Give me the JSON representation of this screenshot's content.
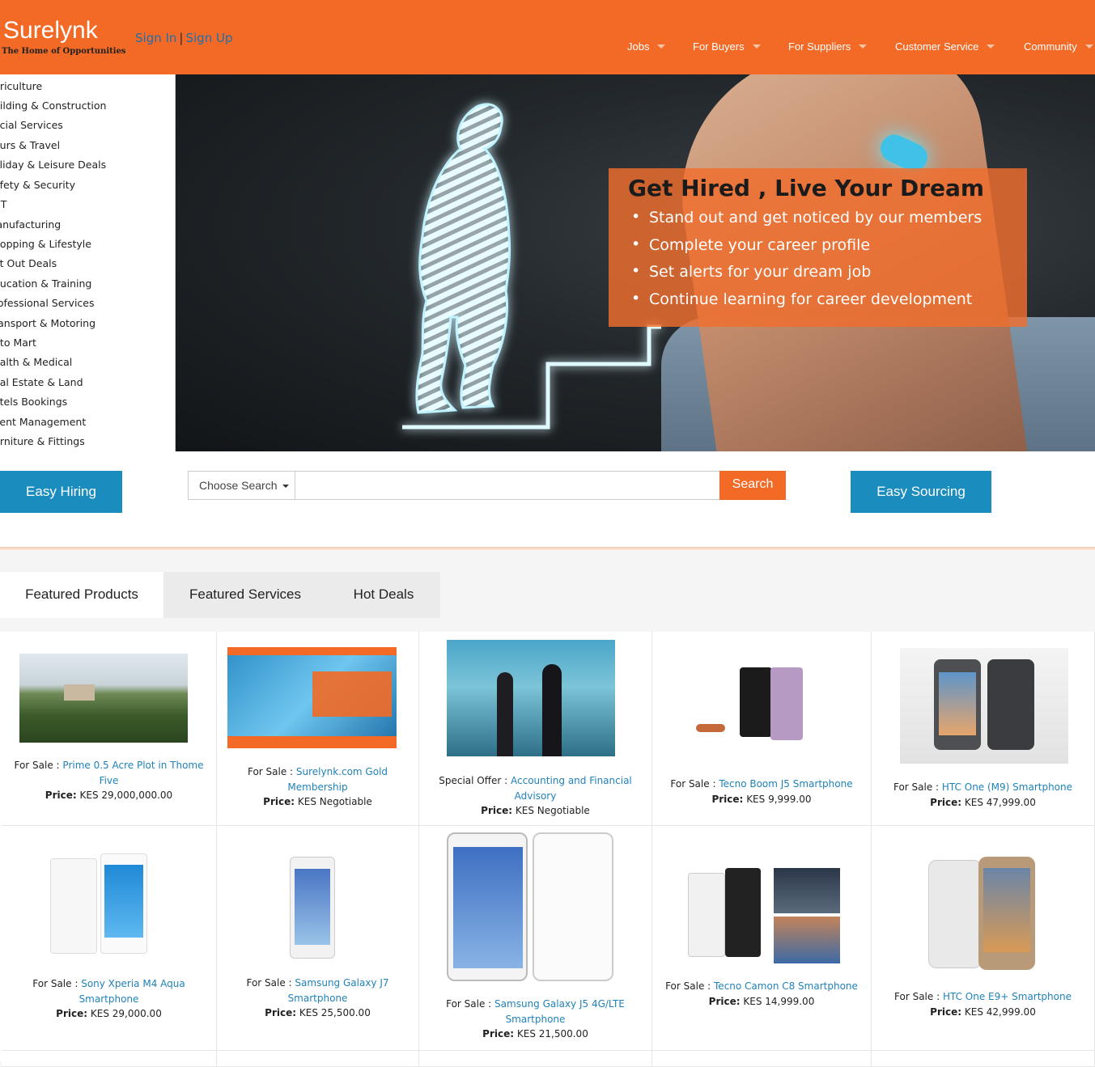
{
  "header": {
    "logo": "Surelynk",
    "tagline": "The Home of Opportunities",
    "sign_in": "Sign In",
    "separator": "|",
    "sign_up": "Sign Up",
    "nav": [
      "Jobs",
      "For Buyers",
      "For Suppliers",
      "Customer Service",
      "Community"
    ]
  },
  "sidebar": {
    "categories": [
      "griculture",
      "uilding & Construction",
      "ocial Services",
      "ours & Travel",
      "oliday & Leisure Deals",
      "afety & Security",
      "CT",
      "lanufacturing",
      "hopping & Lifestyle",
      "at Out Deals",
      "ducation & Training",
      "rofessional Services",
      "ransport & Motoring",
      "uto Mart",
      "ealth & Medical",
      "eal Estate & Land",
      "otels Bookings",
      "vent Management",
      "urniture & Fittings"
    ]
  },
  "banner": {
    "title": "Get Hired , Live Your Dream",
    "points": [
      "Stand out and get noticed by our members",
      "Complete your career profile",
      "Set alerts for your dream job",
      "Continue learning for career development"
    ]
  },
  "actions": {
    "easy_hiring": "Easy Hiring",
    "choose_search": "Choose Search",
    "search_placeholder": "",
    "search_button": "Search",
    "easy_sourcing": "Easy Sourcing"
  },
  "tabs": [
    "Featured Products",
    "Featured Services",
    "Hot Deals"
  ],
  "price_label": "Price:",
  "products": [
    {
      "kind": "For Sale :",
      "name": "Prime 0.5 Acre Plot in Thome Five",
      "price": "KES 29,000,000.00"
    },
    {
      "kind": "For Sale :",
      "name": "Surelynk.com Gold Membership",
      "price": "KES Negotiable"
    },
    {
      "kind": "Special Offer :",
      "name": "Accounting and Financial Advisory",
      "price": "KES Negotiable"
    },
    {
      "kind": "For Sale :",
      "name": "Tecno Boom J5 Smartphone",
      "price": "KES 9,999.00"
    },
    {
      "kind": "For Sale :",
      "name": "HTC One (M9) Smartphone",
      "price": "KES 47,999.00"
    },
    {
      "kind": "For Sale :",
      "name": "Sony Xperia M4 Aqua Smartphone",
      "price": "KES 29,000.00"
    },
    {
      "kind": "For Sale :",
      "name": "Samsung Galaxy J7 Smartphone",
      "price": "KES 25,500.00"
    },
    {
      "kind": "For Sale :",
      "name": "Samsung Galaxy J5 4G/LTE Smartphone",
      "price": "KES 21,500.00"
    },
    {
      "kind": "For Sale :",
      "name": "Tecno Camon C8 Smartphone",
      "price": "KES 14,999.00"
    },
    {
      "kind": "For Sale :",
      "name": "HTC One E9+ Smartphone",
      "price": "KES 42,999.00"
    }
  ],
  "colors": {
    "brand_orange": "#f26a25",
    "action_blue": "#1a8cbe",
    "link_blue": "#1f82b8"
  }
}
